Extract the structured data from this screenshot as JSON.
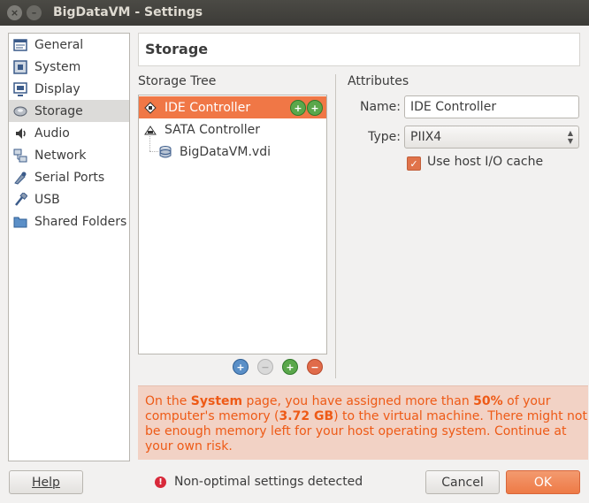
{
  "window": {
    "title": "BigDataVM - Settings",
    "close_glyph": "×",
    "min_glyph": "–"
  },
  "sidebar": {
    "items": [
      {
        "label": "General",
        "icon": "general-icon"
      },
      {
        "label": "System",
        "icon": "system-icon"
      },
      {
        "label": "Display",
        "icon": "display-icon"
      },
      {
        "label": "Storage",
        "icon": "storage-icon",
        "selected": true
      },
      {
        "label": "Audio",
        "icon": "audio-icon"
      },
      {
        "label": "Network",
        "icon": "network-icon"
      },
      {
        "label": "Serial Ports",
        "icon": "serial-ports-icon"
      },
      {
        "label": "USB",
        "icon": "usb-icon"
      },
      {
        "label": "Shared Folders",
        "icon": "shared-folders-icon"
      }
    ]
  },
  "header": {
    "title": "Storage"
  },
  "storage_tree": {
    "title": "Storage Tree",
    "ide_controller": "IDE Controller",
    "sata_controller": "SATA Controller",
    "disk": "BigDataVM.vdi"
  },
  "attributes": {
    "title": "Attributes",
    "name_label": "Name:",
    "name_value": "IDE Controller",
    "type_label": "Type:",
    "type_value": "PIIX4",
    "host_io_cache_label": "Use host I/O cache",
    "host_io_cache_checked": true
  },
  "warning": {
    "p1": "On the ",
    "b1": "System",
    "p2": " page, you have assigned more than ",
    "b2": "50%",
    "p3": " of your computer's memory (",
    "b3": "3.72 GB",
    "p4": ") to the virtual machine. There might not be enough memory left for your host operating system. Continue at your own risk."
  },
  "footer": {
    "help": "Help",
    "status": "Non-optimal settings detected",
    "cancel": "Cancel",
    "ok": "OK"
  },
  "colors": {
    "accent": "#f07746",
    "warning_text": "#ee5a16",
    "warning_bg": "#f2d2c5"
  }
}
